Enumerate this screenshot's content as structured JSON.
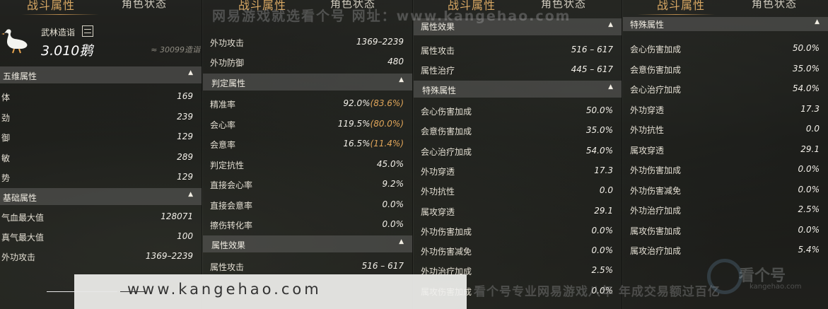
{
  "watermark": {
    "top": "网易游戏就选看个号  网址：www.kangehao.com",
    "url": "www.kangehao.com",
    "slogan": "看个号专业网易游戏八年  年成交易额过百亿",
    "logo_text": "看个号",
    "logo_sub": "kangehao.com"
  },
  "tabs": {
    "combat": "战斗属性",
    "role": "角色状态"
  },
  "panel1": {
    "identity_label": "武林造诣",
    "identity_value": "3.010鹅",
    "identity_note": "≈ 30099造诣",
    "sections": {
      "five": "五维属性",
      "basic": "基础属性"
    },
    "five_rows": [
      {
        "label": "体",
        "value": "169"
      },
      {
        "label": "劲",
        "value": "239"
      },
      {
        "label": "御",
        "value": "129"
      },
      {
        "label": "敏",
        "value": "289"
      },
      {
        "label": "势",
        "value": "129"
      }
    ],
    "basic_rows": [
      {
        "label": "气血最大值",
        "value": "128071"
      },
      {
        "label": "真气最大值",
        "value": "100"
      },
      {
        "label": "外功攻击",
        "value": "1369–2239"
      }
    ]
  },
  "panel2": {
    "top_rows": [
      {
        "label": "外功攻击",
        "value": "1369–2239"
      },
      {
        "label": "外功防御",
        "value": "480"
      }
    ],
    "sections": {
      "judge": "判定属性",
      "attr": "属性效果"
    },
    "judge_rows": [
      {
        "label": "精准率",
        "value": "92.0%",
        "extra": "(83.6%)"
      },
      {
        "label": "会心率",
        "value": "119.5%",
        "extra": "(80.0%)"
      },
      {
        "label": "会意率",
        "value": "16.5%",
        "extra": "(11.4%)"
      },
      {
        "label": "判定抗性",
        "value": "45.0%",
        "extra": ""
      },
      {
        "label": "直接会心率",
        "value": "9.2%",
        "extra": ""
      },
      {
        "label": "直接会意率",
        "value": "0.0%",
        "extra": ""
      },
      {
        "label": "擦伤转化率",
        "value": "0.0%",
        "extra": ""
      }
    ],
    "attr_rows": [
      {
        "label": "属性攻击",
        "value": "516 – 617"
      }
    ]
  },
  "panel3": {
    "sections": {
      "attr": "属性效果",
      "special": "特殊属性"
    },
    "attr_rows": [
      {
        "label": "属性攻击",
        "value": "516 – 617"
      },
      {
        "label": "属性治疗",
        "value": "445 – 617"
      }
    ],
    "special_rows": [
      {
        "label": "会心伤害加成",
        "value": "50.0%"
      },
      {
        "label": "会意伤害加成",
        "value": "35.0%"
      },
      {
        "label": "会心治疗加成",
        "value": "54.0%"
      },
      {
        "label": "外功穿透",
        "value": "17.3"
      },
      {
        "label": "外功抗性",
        "value": "0.0"
      },
      {
        "label": "属攻穿透",
        "value": "29.1"
      },
      {
        "label": "外功伤害加成",
        "value": "0.0%"
      },
      {
        "label": "外功伤害减免",
        "value": "0.0%"
      },
      {
        "label": "外功治疗加成",
        "value": "2.5%"
      },
      {
        "label": "属攻伤害加成",
        "value": "0.0%"
      }
    ]
  },
  "panel4": {
    "sections": {
      "special": "特殊属性"
    },
    "special_rows": [
      {
        "label": "会心伤害加成",
        "value": "50.0%"
      },
      {
        "label": "会意伤害加成",
        "value": "35.0%"
      },
      {
        "label": "会心治疗加成",
        "value": "54.0%"
      },
      {
        "label": "外功穿透",
        "value": "17.3"
      },
      {
        "label": "外功抗性",
        "value": "0.0"
      },
      {
        "label": "属攻穿透",
        "value": "29.1"
      },
      {
        "label": "外功伤害加成",
        "value": "0.0%"
      },
      {
        "label": "外功伤害减免",
        "value": "0.0%"
      },
      {
        "label": "外功治疗加成",
        "value": "2.5%"
      },
      {
        "label": "属攻伤害加成",
        "value": "0.0%"
      },
      {
        "label": "属攻治疗加成",
        "value": "5.4%"
      }
    ]
  }
}
